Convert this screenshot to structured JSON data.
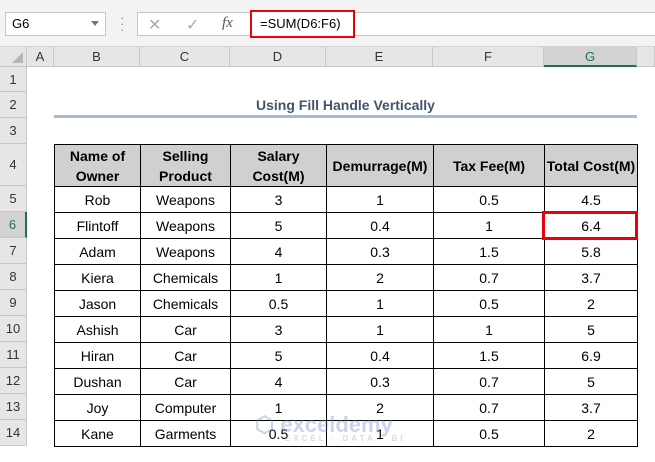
{
  "name_box": "G6",
  "formula": "=SUM(D6:F6)",
  "fx_label": "fx",
  "cancel_glyph": "✕",
  "enter_glyph": "✓",
  "columns": [
    "A",
    "B",
    "C",
    "D",
    "E",
    "F",
    "G"
  ],
  "rows": [
    "1",
    "2",
    "3",
    "4",
    "5",
    "6",
    "7",
    "8",
    "9",
    "10",
    "11",
    "12",
    "13",
    "14"
  ],
  "title": "Using Fill Handle Vertically",
  "table": {
    "headers": [
      "Name of Owner",
      "Selling Product",
      "Salary Cost(M)",
      "Demurrage(M)",
      "Tax Fee(M)",
      "Total Cost(M)"
    ],
    "rows": [
      [
        "Rob",
        "Weapons",
        "3",
        "1",
        "0.5",
        "4.5"
      ],
      [
        "Flintoff",
        "Weapons",
        "5",
        "0.4",
        "1",
        "6.4"
      ],
      [
        "Adam",
        "Weapons",
        "4",
        "0.3",
        "1.5",
        "5.8"
      ],
      [
        "Kiera",
        "Chemicals",
        "1",
        "2",
        "0.7",
        "3.7"
      ],
      [
        "Jason",
        "Chemicals",
        "0.5",
        "1",
        "0.5",
        "2"
      ],
      [
        "Ashish",
        "Car",
        "3",
        "1",
        "1",
        "5"
      ],
      [
        "Hiran",
        "Car",
        "5",
        "0.4",
        "1.5",
        "6.9"
      ],
      [
        "Dushan",
        "Car",
        "4",
        "0.3",
        "0.7",
        "5"
      ],
      [
        "Joy",
        "Computer",
        "1",
        "2",
        "0.7",
        "3.7"
      ],
      [
        "Kane",
        "Garments",
        "0.5",
        "1",
        "0.5",
        "2"
      ]
    ]
  },
  "watermark": {
    "name": "exceldemy",
    "tagline": "EXCEL · DATA · BI"
  }
}
